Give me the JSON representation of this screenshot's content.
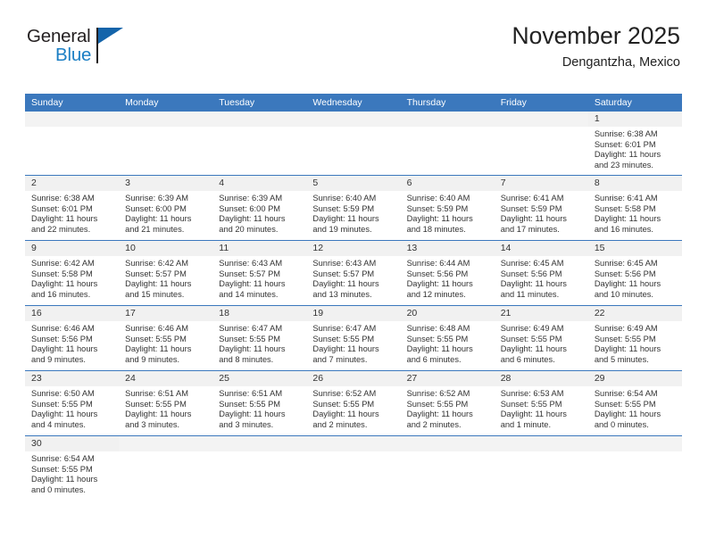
{
  "brand": {
    "name_top": "General",
    "name_bottom": "Blue",
    "accent_color": "#1c7fc4",
    "flag_color": "#1464aa"
  },
  "header": {
    "title": "November 2025",
    "subtitle": "Dengantzha, Mexico"
  },
  "theme": {
    "header_row_color": "#3b78bd",
    "date_strip_color": "#f1f1f1",
    "text_color": "#333333"
  },
  "weekdays": [
    "Sunday",
    "Monday",
    "Tuesday",
    "Wednesday",
    "Thursday",
    "Friday",
    "Saturday"
  ],
  "weeks": [
    [
      {
        "date": "",
        "sunrise": "",
        "sunset": "",
        "daylight_line1": "",
        "daylight_line2": ""
      },
      {
        "date": "",
        "sunrise": "",
        "sunset": "",
        "daylight_line1": "",
        "daylight_line2": ""
      },
      {
        "date": "",
        "sunrise": "",
        "sunset": "",
        "daylight_line1": "",
        "daylight_line2": ""
      },
      {
        "date": "",
        "sunrise": "",
        "sunset": "",
        "daylight_line1": "",
        "daylight_line2": ""
      },
      {
        "date": "",
        "sunrise": "",
        "sunset": "",
        "daylight_line1": "",
        "daylight_line2": ""
      },
      {
        "date": "",
        "sunrise": "",
        "sunset": "",
        "daylight_line1": "",
        "daylight_line2": ""
      },
      {
        "date": "1",
        "sunrise": "Sunrise: 6:38 AM",
        "sunset": "Sunset: 6:01 PM",
        "daylight_line1": "Daylight: 11 hours",
        "daylight_line2": "and 23 minutes."
      }
    ],
    [
      {
        "date": "2",
        "sunrise": "Sunrise: 6:38 AM",
        "sunset": "Sunset: 6:01 PM",
        "daylight_line1": "Daylight: 11 hours",
        "daylight_line2": "and 22 minutes."
      },
      {
        "date": "3",
        "sunrise": "Sunrise: 6:39 AM",
        "sunset": "Sunset: 6:00 PM",
        "daylight_line1": "Daylight: 11 hours",
        "daylight_line2": "and 21 minutes."
      },
      {
        "date": "4",
        "sunrise": "Sunrise: 6:39 AM",
        "sunset": "Sunset: 6:00 PM",
        "daylight_line1": "Daylight: 11 hours",
        "daylight_line2": "and 20 minutes."
      },
      {
        "date": "5",
        "sunrise": "Sunrise: 6:40 AM",
        "sunset": "Sunset: 5:59 PM",
        "daylight_line1": "Daylight: 11 hours",
        "daylight_line2": "and 19 minutes."
      },
      {
        "date": "6",
        "sunrise": "Sunrise: 6:40 AM",
        "sunset": "Sunset: 5:59 PM",
        "daylight_line1": "Daylight: 11 hours",
        "daylight_line2": "and 18 minutes."
      },
      {
        "date": "7",
        "sunrise": "Sunrise: 6:41 AM",
        "sunset": "Sunset: 5:59 PM",
        "daylight_line1": "Daylight: 11 hours",
        "daylight_line2": "and 17 minutes."
      },
      {
        "date": "8",
        "sunrise": "Sunrise: 6:41 AM",
        "sunset": "Sunset: 5:58 PM",
        "daylight_line1": "Daylight: 11 hours",
        "daylight_line2": "and 16 minutes."
      }
    ],
    [
      {
        "date": "9",
        "sunrise": "Sunrise: 6:42 AM",
        "sunset": "Sunset: 5:58 PM",
        "daylight_line1": "Daylight: 11 hours",
        "daylight_line2": "and 16 minutes."
      },
      {
        "date": "10",
        "sunrise": "Sunrise: 6:42 AM",
        "sunset": "Sunset: 5:57 PM",
        "daylight_line1": "Daylight: 11 hours",
        "daylight_line2": "and 15 minutes."
      },
      {
        "date": "11",
        "sunrise": "Sunrise: 6:43 AM",
        "sunset": "Sunset: 5:57 PM",
        "daylight_line1": "Daylight: 11 hours",
        "daylight_line2": "and 14 minutes."
      },
      {
        "date": "12",
        "sunrise": "Sunrise: 6:43 AM",
        "sunset": "Sunset: 5:57 PM",
        "daylight_line1": "Daylight: 11 hours",
        "daylight_line2": "and 13 minutes."
      },
      {
        "date": "13",
        "sunrise": "Sunrise: 6:44 AM",
        "sunset": "Sunset: 5:56 PM",
        "daylight_line1": "Daylight: 11 hours",
        "daylight_line2": "and 12 minutes."
      },
      {
        "date": "14",
        "sunrise": "Sunrise: 6:45 AM",
        "sunset": "Sunset: 5:56 PM",
        "daylight_line1": "Daylight: 11 hours",
        "daylight_line2": "and 11 minutes."
      },
      {
        "date": "15",
        "sunrise": "Sunrise: 6:45 AM",
        "sunset": "Sunset: 5:56 PM",
        "daylight_line1": "Daylight: 11 hours",
        "daylight_line2": "and 10 minutes."
      }
    ],
    [
      {
        "date": "16",
        "sunrise": "Sunrise: 6:46 AM",
        "sunset": "Sunset: 5:56 PM",
        "daylight_line1": "Daylight: 11 hours",
        "daylight_line2": "and 9 minutes."
      },
      {
        "date": "17",
        "sunrise": "Sunrise: 6:46 AM",
        "sunset": "Sunset: 5:55 PM",
        "daylight_line1": "Daylight: 11 hours",
        "daylight_line2": "and 9 minutes."
      },
      {
        "date": "18",
        "sunrise": "Sunrise: 6:47 AM",
        "sunset": "Sunset: 5:55 PM",
        "daylight_line1": "Daylight: 11 hours",
        "daylight_line2": "and 8 minutes."
      },
      {
        "date": "19",
        "sunrise": "Sunrise: 6:47 AM",
        "sunset": "Sunset: 5:55 PM",
        "daylight_line1": "Daylight: 11 hours",
        "daylight_line2": "and 7 minutes."
      },
      {
        "date": "20",
        "sunrise": "Sunrise: 6:48 AM",
        "sunset": "Sunset: 5:55 PM",
        "daylight_line1": "Daylight: 11 hours",
        "daylight_line2": "and 6 minutes."
      },
      {
        "date": "21",
        "sunrise": "Sunrise: 6:49 AM",
        "sunset": "Sunset: 5:55 PM",
        "daylight_line1": "Daylight: 11 hours",
        "daylight_line2": "and 6 minutes."
      },
      {
        "date": "22",
        "sunrise": "Sunrise: 6:49 AM",
        "sunset": "Sunset: 5:55 PM",
        "daylight_line1": "Daylight: 11 hours",
        "daylight_line2": "and 5 minutes."
      }
    ],
    [
      {
        "date": "23",
        "sunrise": "Sunrise: 6:50 AM",
        "sunset": "Sunset: 5:55 PM",
        "daylight_line1": "Daylight: 11 hours",
        "daylight_line2": "and 4 minutes."
      },
      {
        "date": "24",
        "sunrise": "Sunrise: 6:51 AM",
        "sunset": "Sunset: 5:55 PM",
        "daylight_line1": "Daylight: 11 hours",
        "daylight_line2": "and 3 minutes."
      },
      {
        "date": "25",
        "sunrise": "Sunrise: 6:51 AM",
        "sunset": "Sunset: 5:55 PM",
        "daylight_line1": "Daylight: 11 hours",
        "daylight_line2": "and 3 minutes."
      },
      {
        "date": "26",
        "sunrise": "Sunrise: 6:52 AM",
        "sunset": "Sunset: 5:55 PM",
        "daylight_line1": "Daylight: 11 hours",
        "daylight_line2": "and 2 minutes."
      },
      {
        "date": "27",
        "sunrise": "Sunrise: 6:52 AM",
        "sunset": "Sunset: 5:55 PM",
        "daylight_line1": "Daylight: 11 hours",
        "daylight_line2": "and 2 minutes."
      },
      {
        "date": "28",
        "sunrise": "Sunrise: 6:53 AM",
        "sunset": "Sunset: 5:55 PM",
        "daylight_line1": "Daylight: 11 hours",
        "daylight_line2": "and 1 minute."
      },
      {
        "date": "29",
        "sunrise": "Sunrise: 6:54 AM",
        "sunset": "Sunset: 5:55 PM",
        "daylight_line1": "Daylight: 11 hours",
        "daylight_line2": "and 0 minutes."
      }
    ],
    [
      {
        "date": "30",
        "sunrise": "Sunrise: 6:54 AM",
        "sunset": "Sunset: 5:55 PM",
        "daylight_line1": "Daylight: 11 hours",
        "daylight_line2": "and 0 minutes."
      },
      {
        "date": "",
        "sunrise": "",
        "sunset": "",
        "daylight_line1": "",
        "daylight_line2": ""
      },
      {
        "date": "",
        "sunrise": "",
        "sunset": "",
        "daylight_line1": "",
        "daylight_line2": ""
      },
      {
        "date": "",
        "sunrise": "",
        "sunset": "",
        "daylight_line1": "",
        "daylight_line2": ""
      },
      {
        "date": "",
        "sunrise": "",
        "sunset": "",
        "daylight_line1": "",
        "daylight_line2": ""
      },
      {
        "date": "",
        "sunrise": "",
        "sunset": "",
        "daylight_line1": "",
        "daylight_line2": ""
      },
      {
        "date": "",
        "sunrise": "",
        "sunset": "",
        "daylight_line1": "",
        "daylight_line2": ""
      }
    ]
  ]
}
